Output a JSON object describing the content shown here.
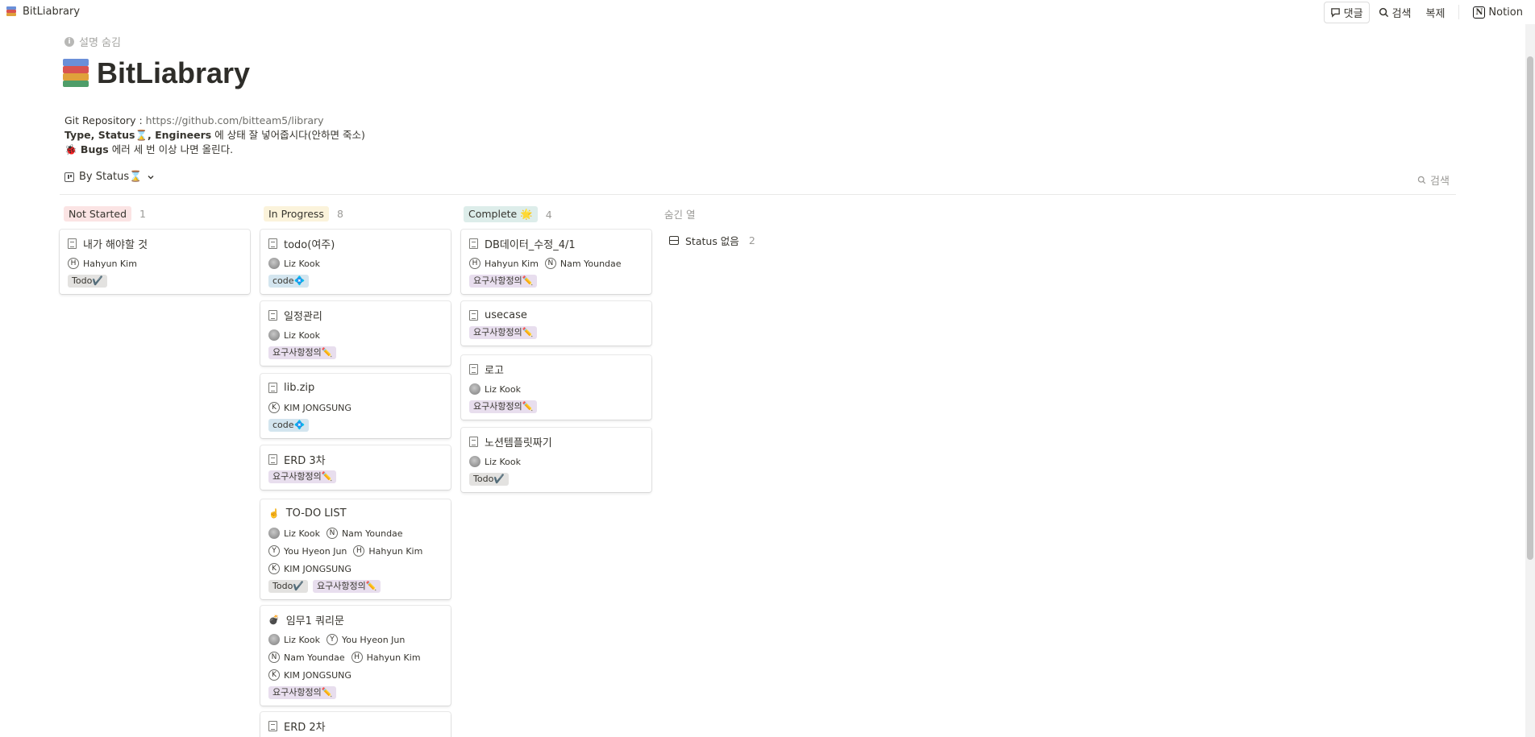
{
  "topbar": {
    "title": "BitLiabrary",
    "comment_label": "댓글",
    "search_label": "검색",
    "duplicate_label": "복제",
    "notion_label": "Notion"
  },
  "page": {
    "hide_description": "설명 숨김",
    "title": "BitLiabrary",
    "desc": {
      "repo_prefix": "Git Repository : ",
      "repo_link": "https://github.com/bitteam5/library",
      "line2_bold": "Type, Status⌛, Engineers",
      "line2_rest": " 에 상태 잘 넣어줍시다(안하면 죽소)",
      "line3_icon": "🐞",
      "line3_bold": " Bugs",
      "line3_rest": " 에러 세 번 이상 나면 올린다."
    }
  },
  "view": {
    "name": "By Status⌛",
    "search_label": "검색"
  },
  "columns": {
    "not_started": {
      "label": "Not Started",
      "count": "1"
    },
    "in_progress": {
      "label": "In Progress",
      "count": "8"
    },
    "complete": {
      "label": "Complete 🌟",
      "count": "4"
    }
  },
  "hidden": {
    "label": "숨긴 열",
    "no_status_label": "Status 없음",
    "no_status_count": "2"
  },
  "cards": {
    "ns1": {
      "title": "내가 해야할 것",
      "people": [
        "Hahyun Kim"
      ],
      "tags": [
        "Todo✔️"
      ]
    },
    "ip1": {
      "title": "todo(여주)",
      "people": [
        "Liz Kook"
      ],
      "tags": [
        "code💠"
      ]
    },
    "ip2": {
      "title": "일정관리",
      "people": [
        "Liz Kook"
      ],
      "tags": [
        "요구사항정의✏️"
      ]
    },
    "ip3": {
      "title": "lib.zip",
      "people": [
        "KIM JONGSUNG"
      ],
      "tags": [
        "code💠"
      ]
    },
    "ip4": {
      "title": "ERD 3차",
      "tags": [
        "요구사항정의✏️"
      ]
    },
    "ip5": {
      "icon": "☝️",
      "title": "TO-DO LIST",
      "people": [
        "Liz Kook",
        "Nam Youndae",
        "You Hyeon Jun",
        "Hahyun Kim",
        "KIM JONGSUNG"
      ],
      "tags": [
        "Todo✔️",
        "요구사항정의✏️"
      ]
    },
    "ip6": {
      "icon": "💣",
      "title": "임무1 쿼리문",
      "people": [
        "Liz Kook",
        "You Hyeon Jun",
        "Nam Youndae",
        "Hahyun Kim",
        "KIM JONGSUNG"
      ],
      "tags": [
        "요구사항정의✏️"
      ]
    },
    "ip7": {
      "title": "ERD 2차"
    },
    "c1": {
      "title": "DB데이터_수정_4/1",
      "people": [
        "Hahyun Kim",
        "Nam Youndae"
      ],
      "tags": [
        "요구사항정의✏️"
      ]
    },
    "c2": {
      "title": "usecase",
      "tags": [
        "요구사항정의✏️"
      ]
    },
    "c3": {
      "title": "로고",
      "people": [
        "Liz Kook"
      ],
      "tags": [
        "요구사항정의✏️"
      ]
    },
    "c4": {
      "title": "노션템플릿짜기",
      "people": [
        "Liz Kook"
      ],
      "tags": [
        "Todo✔️"
      ]
    }
  },
  "avatar_letters": {
    "Hahyun Kim": "H",
    "Nam Youndae": "N",
    "You Hyeon Jun": "Y",
    "KIM JONGSUNG": "K"
  },
  "colors": {
    "not_started_bg": "#fbe4e4",
    "in_progress_bg": "#fbf3db",
    "complete_bg": "#ddedea",
    "tag_todo_bg": "#e3e2e0",
    "tag_code_bg": "#d3e5ef",
    "tag_req_bg": "#e8deee"
  }
}
